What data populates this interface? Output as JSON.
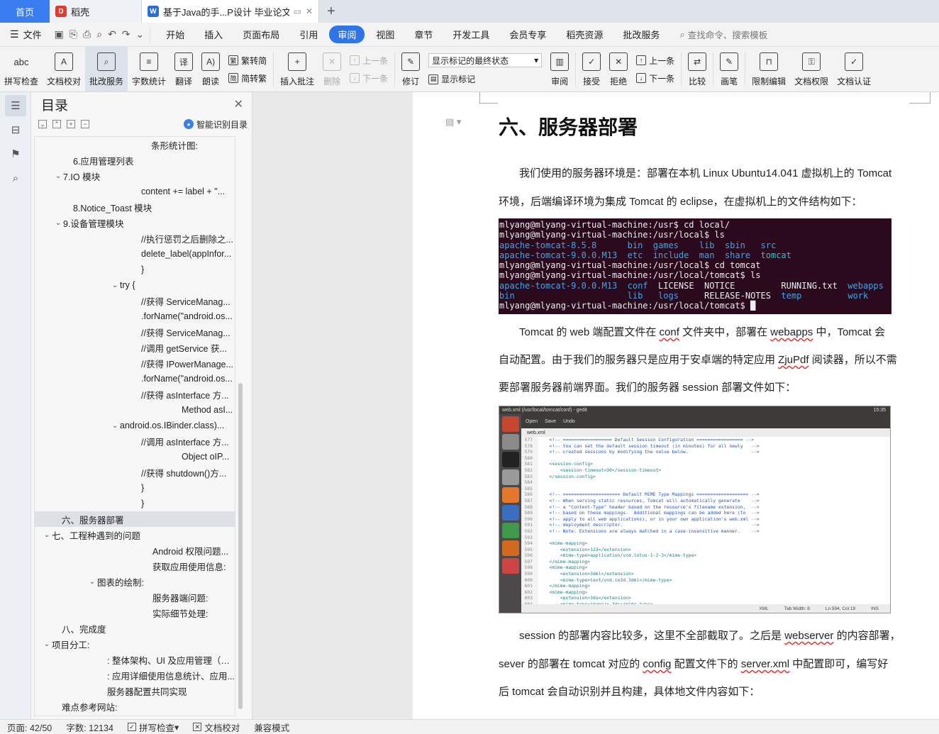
{
  "tabs": {
    "home": "首页",
    "daoke": "稻壳",
    "document": "基于Java的手...P设计 毕业论文"
  },
  "menubar": {
    "file": "文件",
    "items": [
      "开始",
      "插入",
      "页面布局",
      "引用",
      "审阅",
      "视图",
      "章节",
      "开发工具",
      "会员专享",
      "稻壳资源",
      "批改服务"
    ],
    "active_index": 4,
    "search_placeholder": "查找命令、搜索模板"
  },
  "ribbon": {
    "spellcheck": "拼写检查",
    "spellcheck_icon_text": "abc",
    "doc_proof": "文档校对",
    "batch_service": "批改服务",
    "word_count": "字数统计",
    "translate": "翻译",
    "read_aloud": "朗读",
    "trad_to_simp": "繁转简",
    "simp_to_trad": "简转繁",
    "insert_comment": "插入批注",
    "delete": "删除",
    "prev_comment": "上一条",
    "next_comment": "下一条",
    "revise": "修订",
    "markup_mode": "显示标记的最终状态",
    "show_markup": "显示标记",
    "review": "审阅",
    "accept": "接受",
    "reject": "拒绝",
    "prev_change": "上一条",
    "next_change": "下一条",
    "compare": "比较",
    "pen": "画笔",
    "restrict_edit": "限制编辑",
    "doc_permission": "文档权限",
    "doc_cert": "文档认证"
  },
  "toc": {
    "title": "目录",
    "smart_toc": "智能识别目录",
    "items": [
      {
        "text": "条形统计图:",
        "indent": 150,
        "arrow": ""
      },
      {
        "text": "6.应用管理列表",
        "indent": 40,
        "arrow": ""
      },
      {
        "text": "7.IO 模块",
        "indent": 26,
        "arrow": "v"
      },
      {
        "text": "content += label + \"...",
        "indent": 136,
        "arrow": ""
      },
      {
        "text": "8.Notice_Toast 模块",
        "indent": 40,
        "arrow": ""
      },
      {
        "text": "9.设备管理模块",
        "indent": 26,
        "arrow": "v"
      },
      {
        "text": "//执行惩罚之后删除之...",
        "indent": 136,
        "arrow": ""
      },
      {
        "text": "delete_label(appInfor...",
        "indent": 136,
        "arrow": ""
      },
      {
        "text": "}",
        "indent": 136,
        "arrow": ""
      },
      {
        "text": "try {",
        "indent": 106,
        "arrow": "v"
      },
      {
        "text": "//获得 ServiceManag...",
        "indent": 136,
        "arrow": ""
      },
      {
        "text": ".forName(\"android.os...",
        "indent": 136,
        "arrow": ""
      },
      {
        "text": "//获得 ServiceManag...",
        "indent": 136,
        "arrow": ""
      },
      {
        "text": "//调用 getService 获...",
        "indent": 136,
        "arrow": ""
      },
      {
        "text": "//获得 IPowerManage...",
        "indent": 136,
        "arrow": ""
      },
      {
        "text": ".forName(\"android.os...",
        "indent": 136,
        "arrow": ""
      },
      {
        "text": "//获得 asInterface 方...",
        "indent": 136,
        "arrow": ""
      },
      {
        "text": "Method asI...",
        "indent": 193,
        "arrow": ""
      },
      {
        "text": "android.os.IBinder.class)...",
        "indent": 106,
        "arrow": "v"
      },
      {
        "text": "//调用 asInterface 方...",
        "indent": 136,
        "arrow": ""
      },
      {
        "text": "Object oIP...",
        "indent": 193,
        "arrow": ""
      },
      {
        "text": "//获得 shutdown()方...",
        "indent": 136,
        "arrow": ""
      },
      {
        "text": "}",
        "indent": 136,
        "arrow": ""
      },
      {
        "text": "}",
        "indent": 136,
        "arrow": ""
      },
      {
        "text": "六、服务器部署",
        "indent": 24,
        "arrow": "",
        "selected": true
      },
      {
        "text": "七、工程种遇到的问题",
        "indent": 10,
        "arrow": "v"
      },
      {
        "text": "Android 权限问题...",
        "indent": 152,
        "arrow": ""
      },
      {
        "text": "获取应用使用信息:",
        "indent": 152,
        "arrow": ""
      },
      {
        "text": "图表的绘制:",
        "indent": 74,
        "arrow": "v"
      },
      {
        "text": "服务器端问题:",
        "indent": 152,
        "arrow": ""
      },
      {
        "text": "实际细节处理:",
        "indent": 152,
        "arrow": ""
      },
      {
        "text": "八、完成度",
        "indent": 24,
        "arrow": ""
      },
      {
        "text": "项目分工:",
        "indent": 10,
        "arrow": "v"
      },
      {
        "text": ":  整体架构、UI 及应用管理（通...",
        "indent": 88,
        "arrow": ""
      },
      {
        "text": ":  应用详细使用信息统计、应用...",
        "indent": 88,
        "arrow": ""
      },
      {
        "text": "服务器配置共同实现",
        "indent": 88,
        "arrow": ""
      },
      {
        "text": "难点参考网站:",
        "indent": 24,
        "arrow": ""
      }
    ]
  },
  "document": {
    "heading": "六、服务器部署",
    "para1_line1": "我们使用的服务器环境是：部署在本机 Linux Ubuntu14.041 虚拟机上的 Tomcat",
    "para1_line2": "环境，后端编译环境为集成 Tomcat 的 eclipse，在虚拟机上的文件结构如下：",
    "terminal": [
      "mlyang@mlyang-virtual-machine:/usr$ cd local/",
      "mlyang@mlyang-virtual-machine:/usr/local$ ls",
      "apache-tomcat-8.5.8      bin  games    lib  sbin   src",
      "apache-tomcat-9.0.0.M13  etc  include  man  share  tomcat",
      "mlyang@mlyang-virtual-machine:/usr/local$ cd tomcat",
      "mlyang@mlyang-virtual-machine:/usr/local/tomcat$ ls",
      "apache-tomcat-9.0.0.M13  conf  LICENSE  NOTICE         RUNNING.txt  webapps",
      "bin                      lib   logs     RELEASE-NOTES  temp         work",
      "mlyang@mlyang-virtual-machine:/usr/local/tomcat$ "
    ],
    "para2_line1_a": "Tomcat 的 web 端配置文件在 ",
    "para2_line1_conf": "conf",
    "para2_line1_b": " 文件夹中，部署在 ",
    "para2_line1_webapps": "webapps",
    "para2_line1_c": " 中，Tomcat 会",
    "para2_line2_a": "自动配置。由于我们的服务器只是应用于安卓端的特定应用 ",
    "para2_line2_zju": "ZjuPdf",
    "para2_line2_b": " 阅读器，所以不需",
    "para2_line3": "要部署服务器前端界面。我们的服务器 session 部署文件如下：",
    "gedit": {
      "title": "web.xml (/usr/local/tomcat/conf) - gedit",
      "clock": "15:35",
      "open": "Open",
      "save": "Save",
      "undo": "Undo",
      "tab": "web.xml",
      "status_lang": "XML",
      "status_tab": "Tab Width: 8",
      "status_pos": "Ln 594, Col 19",
      "status_ins": "INS",
      "lines": [
        {
          "n": "577",
          "t": "    <!-- ================== Default Session Configuration ================= -->"
        },
        {
          "n": "578",
          "t": "    <!-- You can set the default session timeout (in minutes) for all newly   -->"
        },
        {
          "n": "579",
          "t": "    <!-- created sessions by modifying the value below.                       -->"
        },
        {
          "n": "580",
          "t": ""
        },
        {
          "n": "581",
          "t": "    <session-config>"
        },
        {
          "n": "582",
          "t": "        <session-timeout>30</session-timeout>"
        },
        {
          "n": "583",
          "t": "    </session-config>"
        },
        {
          "n": "584",
          "t": ""
        },
        {
          "n": "585",
          "t": ""
        },
        {
          "n": "586",
          "t": "    <!-- ===================== Default MIME Type Mappings =================== -->"
        },
        {
          "n": "587",
          "t": "    <!-- When serving static resources, Tomcat will automatically generate    -->"
        },
        {
          "n": "588",
          "t": "    <!-- a \"Content-Type\" header based on the resource's filename extension,  -->"
        },
        {
          "n": "589",
          "t": "    <!-- based on these mappings.  Additional mappings can be added here (to  -->"
        },
        {
          "n": "590",
          "t": "    <!-- apply to all web applications), or in your own application's web.xml -->"
        },
        {
          "n": "591",
          "t": "    <!-- deployment descriptor.                                               -->"
        },
        {
          "n": "592",
          "t": "    <!-- Note: Extensions are always matched in a case-insensitive manner.    -->"
        },
        {
          "n": "593",
          "t": ""
        },
        {
          "n": "594",
          "t": "    <mime-mapping>"
        },
        {
          "n": "595",
          "t": "        <extension>123</extension>"
        },
        {
          "n": "596",
          "t": "        <mime-type>application/vnd.lotus-1-2-3</mime-type>"
        },
        {
          "n": "597",
          "t": "    </mime-mapping>"
        },
        {
          "n": "598",
          "t": "    <mime-mapping>"
        },
        {
          "n": "599",
          "t": "        <extension>3dml</extension>"
        },
        {
          "n": "600",
          "t": "        <mime-type>text/vnd.in3d.3dml</mime-type>"
        },
        {
          "n": "601",
          "t": "    </mime-mapping>"
        },
        {
          "n": "602",
          "t": "    <mime-mapping>"
        },
        {
          "n": "603",
          "t": "        <extension>3ds</extension>"
        },
        {
          "n": "604",
          "t": "        <mime-type>image/x-3ds</mime-type>"
        }
      ]
    },
    "para3_line1_a": "session 的部署内容比较多，这里不全部截取了。之后是 ",
    "para3_line1_ws": "webserver",
    "para3_line1_b": " 的内容部署，",
    "para3_line2_a": "sever 的部署在 tomcat 对应的 ",
    "para3_line2_config": "config",
    "para3_line2_b": " 配置文件下的 ",
    "para3_line2_xml": "server.xml",
    "para3_line2_c": " 中配置即可，编写好",
    "para3_line3": "后 tomcat 会自动识别并且构建，具体地文件内容如下："
  },
  "statusbar": {
    "page": "页面: 42/50",
    "words": "字数: 12134",
    "spell": "拼写检查",
    "proof": "文档校对",
    "compat": "兼容模式"
  }
}
